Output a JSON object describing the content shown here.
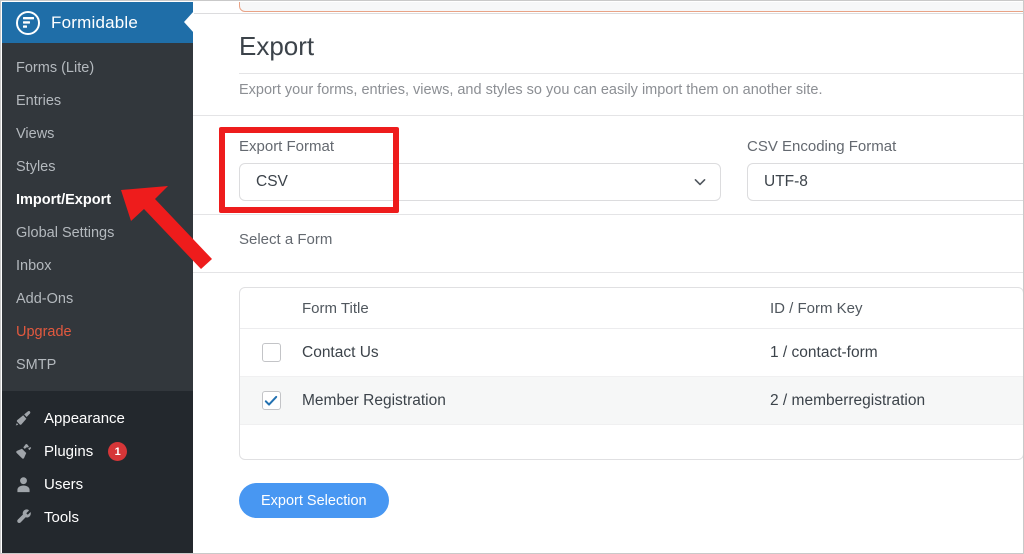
{
  "sidebar": {
    "brand": {
      "title": "Formidable",
      "logo_icon": "formidable-logo-icon",
      "color": "#1f6ea8"
    },
    "plugin_menu": [
      {
        "label": "Forms (Lite)",
        "state": "normal"
      },
      {
        "label": "Entries",
        "state": "normal"
      },
      {
        "label": "Views",
        "state": "normal"
      },
      {
        "label": "Styles",
        "state": "normal"
      },
      {
        "label": "Import/Export",
        "state": "current"
      },
      {
        "label": "Global Settings",
        "state": "normal"
      },
      {
        "label": "Inbox",
        "state": "normal"
      },
      {
        "label": "Add-Ons",
        "state": "normal"
      },
      {
        "label": "Upgrade",
        "state": "upgrade"
      },
      {
        "label": "SMTP",
        "state": "normal"
      }
    ],
    "wp_menu": [
      {
        "label": "Appearance",
        "icon": "paintbrush-icon",
        "badge": null
      },
      {
        "label": "Plugins",
        "icon": "plug-icon",
        "badge": "1"
      },
      {
        "label": "Users",
        "icon": "user-icon",
        "badge": null
      },
      {
        "label": "Tools",
        "icon": "wrench-icon",
        "badge": null
      }
    ],
    "badge_color": "#d63638",
    "upgrade_color": "#e2593f"
  },
  "main": {
    "heading": "Export",
    "description": "Export your forms, entries, views, and styles so you can easily import them on another site.",
    "export_format": {
      "label": "Export Format",
      "value": "CSV",
      "icon": "chevron-down-icon"
    },
    "csv_encoding": {
      "label": "CSV Encoding Format",
      "value": "UTF-8"
    },
    "select_form_label": "Select a Form",
    "table": {
      "columns": [
        "",
        "Form Title",
        "ID / Form Key"
      ],
      "rows": [
        {
          "checked": false,
          "title": "Contact Us",
          "key": "1 / contact-form"
        },
        {
          "checked": true,
          "title": "Member Registration",
          "key": "2 / memberregistration"
        }
      ]
    },
    "export_button": "Export Selection",
    "button_color": "#4897f2"
  },
  "annotations": {
    "highlight_box_color": "#ee1c1c",
    "arrow_color": "#ee1c1c",
    "arrow_target": "Import/Export",
    "highlight_target": "Export Format"
  }
}
